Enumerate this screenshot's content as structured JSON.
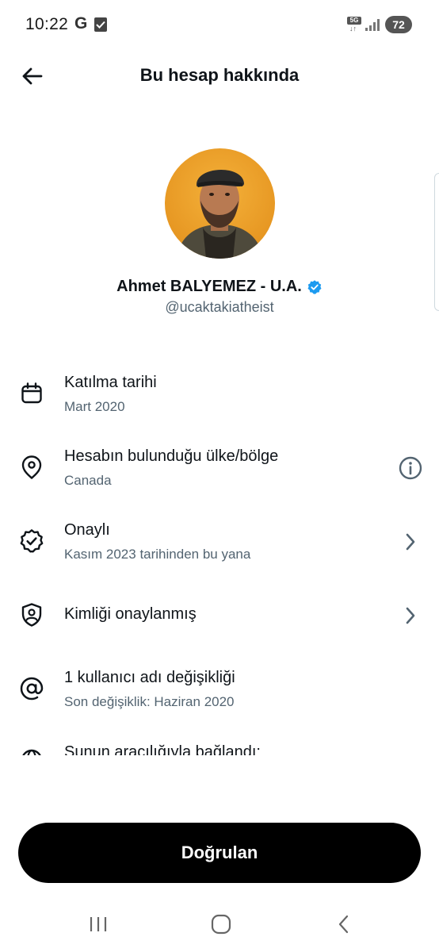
{
  "status_bar": {
    "time": "10:22",
    "g_label": "G",
    "network_label": "5G",
    "battery": "72"
  },
  "header": {
    "title": "Bu hesap hakkında",
    "back_icon": "arrow-left-icon"
  },
  "profile": {
    "name": "Ahmet BALYEMEZ - U.A.",
    "handle": "@ucaktakiatheist",
    "verified_color": "#1d9bf0"
  },
  "items": [
    {
      "title": "Katılma tarihi",
      "subtitle": "Mart 2020",
      "icon": "calendar-icon"
    },
    {
      "title": "Hesabın bulunduğu ülke/bölge",
      "subtitle": "Canada",
      "icon": "location-pin-icon",
      "trailing": "info-icon"
    },
    {
      "title": "Onaylı",
      "subtitle": "Kasım 2023 tarihinden bu yana",
      "icon": "verified-seal-icon",
      "trailing": "chevron-right-icon"
    },
    {
      "title": "Kimliği onaylanmış",
      "icon": "id-shield-icon",
      "trailing": "chevron-right-icon"
    },
    {
      "title": "1 kullanıcı adı değişikliği",
      "subtitle": "Son değişiklik: Haziran 2020",
      "icon": "at-sign-icon"
    },
    {
      "title": "Şunun aracılığıyla bağlandı:",
      "icon": "globe-icon"
    }
  ],
  "cta": {
    "label": "Doğrulan"
  },
  "colors": {
    "text_primary": "#0f1419",
    "text_secondary": "#536471",
    "button_bg": "#000000",
    "button_text": "#ffffff"
  }
}
